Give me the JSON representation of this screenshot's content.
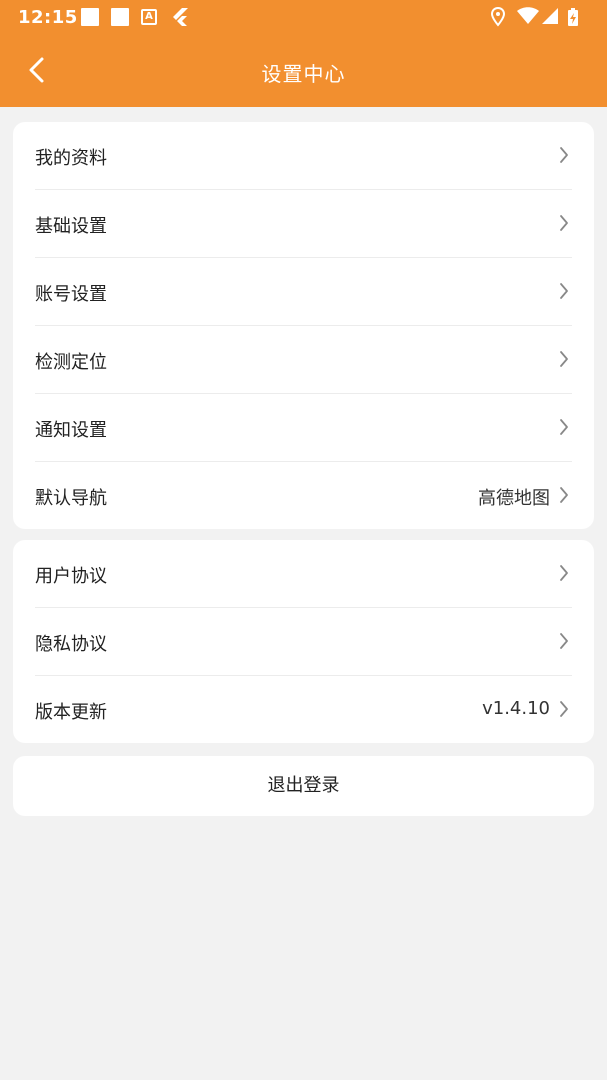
{
  "status_bar": {
    "time": "12:15"
  },
  "header": {
    "title": "设置中心"
  },
  "group1": {
    "items": [
      {
        "label": "我的资料",
        "value": ""
      },
      {
        "label": "基础设置",
        "value": ""
      },
      {
        "label": "账号设置",
        "value": ""
      },
      {
        "label": "检测定位",
        "value": ""
      },
      {
        "label": "通知设置",
        "value": ""
      },
      {
        "label": "默认导航",
        "value": "高德地图"
      }
    ]
  },
  "group2": {
    "items": [
      {
        "label": "用户协议",
        "value": ""
      },
      {
        "label": "隐私协议",
        "value": ""
      },
      {
        "label": "版本更新",
        "value": "v1.4.10"
      }
    ]
  },
  "logout_label": "退出登录",
  "colors": {
    "header": "#f28f2f",
    "background": "#f2f2f2",
    "card": "#ffffff"
  },
  "icons": [
    "back-arrow-icon",
    "chevron-right-icon",
    "location-icon",
    "wifi-icon",
    "signal-icon",
    "battery-icon"
  ]
}
